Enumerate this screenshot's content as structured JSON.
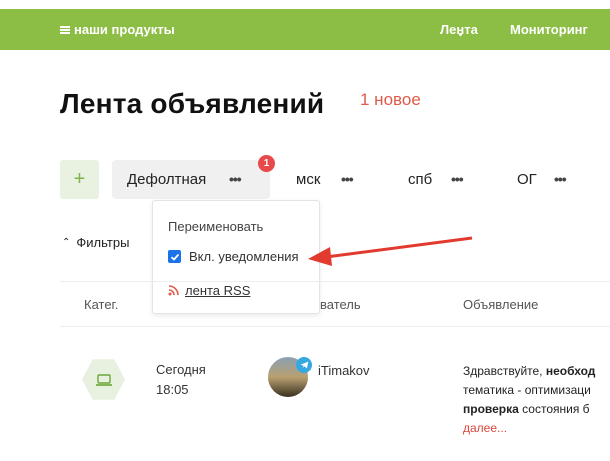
{
  "header": {
    "brand": "наши продукты",
    "nav": [
      "Лента",
      "Мониторинг"
    ],
    "colors": {
      "bar": "#8cbd45"
    }
  },
  "title": "Лента объявлений",
  "new_count": "1 новое",
  "tabs": {
    "add": "+",
    "items": [
      {
        "label": "Дефолтная",
        "more": "•••",
        "badge": "1"
      },
      {
        "label": "мск",
        "more": "•••"
      },
      {
        "label": "спб",
        "more": "•••"
      },
      {
        "label": "ОГ",
        "more": "•••"
      }
    ]
  },
  "dropdown": {
    "rename": "Переименовать",
    "notifications": "Вкл. уведомления",
    "notifications_checked": true,
    "rss": "лента RSS"
  },
  "filters": "Фильтры",
  "table": {
    "columns": [
      "Катег.",
      "ватель",
      "Объявление"
    ],
    "rows": [
      {
        "category_icon": "laptop-icon",
        "date": "Сегодня",
        "time": "18:05",
        "author": "iTimakov",
        "message_parts": {
          "line1_plain": "Здравствуйте, ",
          "line1_bold": "необход",
          "line2": "тематика - оптимизаци",
          "line3_bold": "проверка",
          "line3_plain": " состояния б",
          "more": "далее..."
        }
      }
    ]
  }
}
